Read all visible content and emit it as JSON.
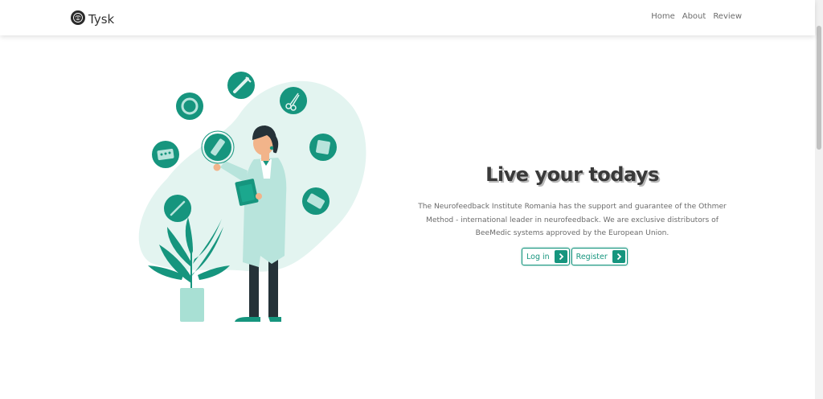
{
  "navbar": {
    "brand_name": "Tysk",
    "links": [
      "Home",
      "About",
      "Review"
    ]
  },
  "hero": {
    "title": "Live your todays",
    "description": "The Neurofeedback Institute Romania has the support and guarantee of the Othmer Method - international leader in neurofeedback. We are exclusive distributors of BeeMedic systems approved by the European Union.",
    "buttons": {
      "login_label": "Log in",
      "register_label": "Register"
    }
  },
  "colors": {
    "accent": "#16957e",
    "blob": "#e3f4f0",
    "text_dark": "#3a3a3a"
  },
  "icons": {
    "brand": "brain-logo-icon",
    "button_arrow": "chevron-right-icon"
  }
}
